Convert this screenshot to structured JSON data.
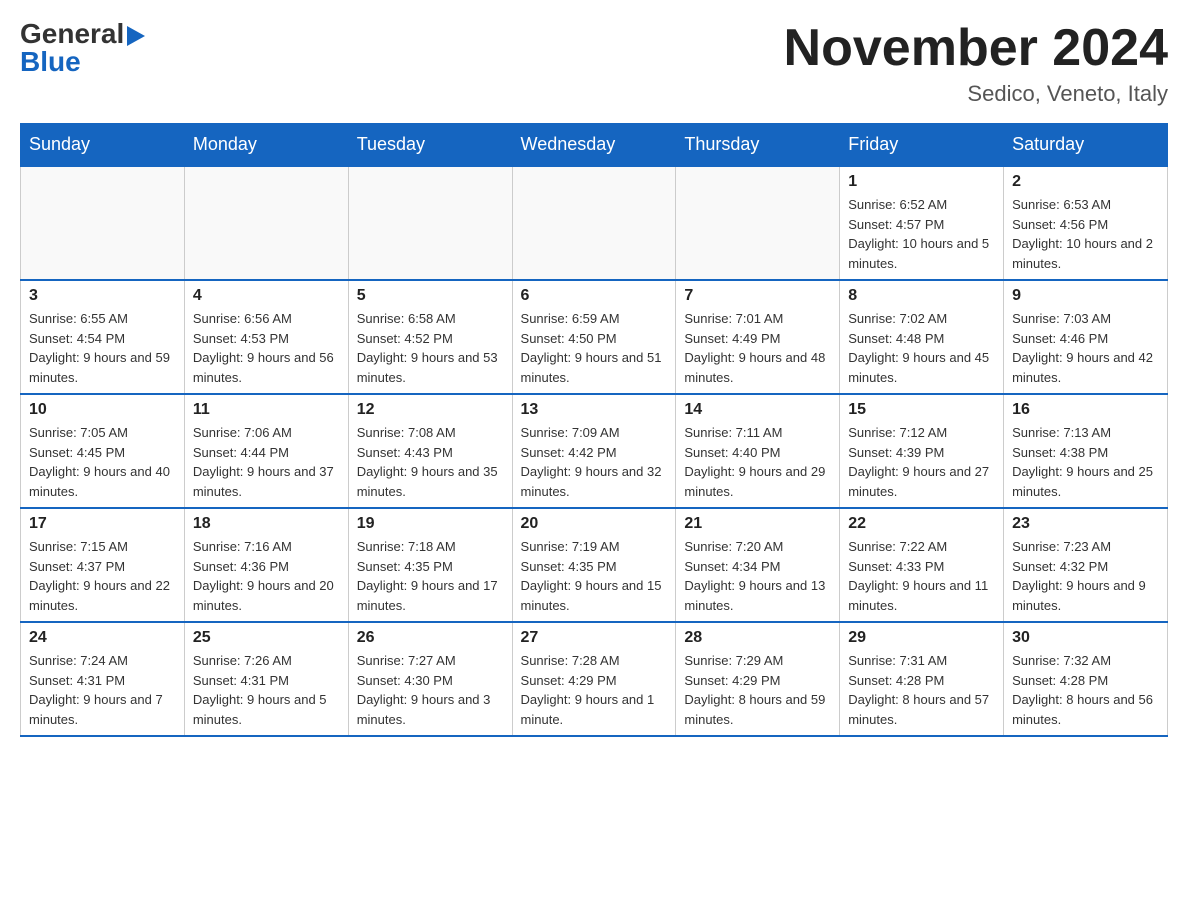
{
  "header": {
    "logo_general": "General",
    "logo_blue": "Blue",
    "month_title": "November 2024",
    "location": "Sedico, Veneto, Italy"
  },
  "weekdays": [
    "Sunday",
    "Monday",
    "Tuesday",
    "Wednesday",
    "Thursday",
    "Friday",
    "Saturday"
  ],
  "weeks": [
    [
      {
        "day": "",
        "info": ""
      },
      {
        "day": "",
        "info": ""
      },
      {
        "day": "",
        "info": ""
      },
      {
        "day": "",
        "info": ""
      },
      {
        "day": "",
        "info": ""
      },
      {
        "day": "1",
        "info": "Sunrise: 6:52 AM\nSunset: 4:57 PM\nDaylight: 10 hours and 5 minutes."
      },
      {
        "day": "2",
        "info": "Sunrise: 6:53 AM\nSunset: 4:56 PM\nDaylight: 10 hours and 2 minutes."
      }
    ],
    [
      {
        "day": "3",
        "info": "Sunrise: 6:55 AM\nSunset: 4:54 PM\nDaylight: 9 hours and 59 minutes."
      },
      {
        "day": "4",
        "info": "Sunrise: 6:56 AM\nSunset: 4:53 PM\nDaylight: 9 hours and 56 minutes."
      },
      {
        "day": "5",
        "info": "Sunrise: 6:58 AM\nSunset: 4:52 PM\nDaylight: 9 hours and 53 minutes."
      },
      {
        "day": "6",
        "info": "Sunrise: 6:59 AM\nSunset: 4:50 PM\nDaylight: 9 hours and 51 minutes."
      },
      {
        "day": "7",
        "info": "Sunrise: 7:01 AM\nSunset: 4:49 PM\nDaylight: 9 hours and 48 minutes."
      },
      {
        "day": "8",
        "info": "Sunrise: 7:02 AM\nSunset: 4:48 PM\nDaylight: 9 hours and 45 minutes."
      },
      {
        "day": "9",
        "info": "Sunrise: 7:03 AM\nSunset: 4:46 PM\nDaylight: 9 hours and 42 minutes."
      }
    ],
    [
      {
        "day": "10",
        "info": "Sunrise: 7:05 AM\nSunset: 4:45 PM\nDaylight: 9 hours and 40 minutes."
      },
      {
        "day": "11",
        "info": "Sunrise: 7:06 AM\nSunset: 4:44 PM\nDaylight: 9 hours and 37 minutes."
      },
      {
        "day": "12",
        "info": "Sunrise: 7:08 AM\nSunset: 4:43 PM\nDaylight: 9 hours and 35 minutes."
      },
      {
        "day": "13",
        "info": "Sunrise: 7:09 AM\nSunset: 4:42 PM\nDaylight: 9 hours and 32 minutes."
      },
      {
        "day": "14",
        "info": "Sunrise: 7:11 AM\nSunset: 4:40 PM\nDaylight: 9 hours and 29 minutes."
      },
      {
        "day": "15",
        "info": "Sunrise: 7:12 AM\nSunset: 4:39 PM\nDaylight: 9 hours and 27 minutes."
      },
      {
        "day": "16",
        "info": "Sunrise: 7:13 AM\nSunset: 4:38 PM\nDaylight: 9 hours and 25 minutes."
      }
    ],
    [
      {
        "day": "17",
        "info": "Sunrise: 7:15 AM\nSunset: 4:37 PM\nDaylight: 9 hours and 22 minutes."
      },
      {
        "day": "18",
        "info": "Sunrise: 7:16 AM\nSunset: 4:36 PM\nDaylight: 9 hours and 20 minutes."
      },
      {
        "day": "19",
        "info": "Sunrise: 7:18 AM\nSunset: 4:35 PM\nDaylight: 9 hours and 17 minutes."
      },
      {
        "day": "20",
        "info": "Sunrise: 7:19 AM\nSunset: 4:35 PM\nDaylight: 9 hours and 15 minutes."
      },
      {
        "day": "21",
        "info": "Sunrise: 7:20 AM\nSunset: 4:34 PM\nDaylight: 9 hours and 13 minutes."
      },
      {
        "day": "22",
        "info": "Sunrise: 7:22 AM\nSunset: 4:33 PM\nDaylight: 9 hours and 11 minutes."
      },
      {
        "day": "23",
        "info": "Sunrise: 7:23 AM\nSunset: 4:32 PM\nDaylight: 9 hours and 9 minutes."
      }
    ],
    [
      {
        "day": "24",
        "info": "Sunrise: 7:24 AM\nSunset: 4:31 PM\nDaylight: 9 hours and 7 minutes."
      },
      {
        "day": "25",
        "info": "Sunrise: 7:26 AM\nSunset: 4:31 PM\nDaylight: 9 hours and 5 minutes."
      },
      {
        "day": "26",
        "info": "Sunrise: 7:27 AM\nSunset: 4:30 PM\nDaylight: 9 hours and 3 minutes."
      },
      {
        "day": "27",
        "info": "Sunrise: 7:28 AM\nSunset: 4:29 PM\nDaylight: 9 hours and 1 minute."
      },
      {
        "day": "28",
        "info": "Sunrise: 7:29 AM\nSunset: 4:29 PM\nDaylight: 8 hours and 59 minutes."
      },
      {
        "day": "29",
        "info": "Sunrise: 7:31 AM\nSunset: 4:28 PM\nDaylight: 8 hours and 57 minutes."
      },
      {
        "day": "30",
        "info": "Sunrise: 7:32 AM\nSunset: 4:28 PM\nDaylight: 8 hours and 56 minutes."
      }
    ]
  ]
}
